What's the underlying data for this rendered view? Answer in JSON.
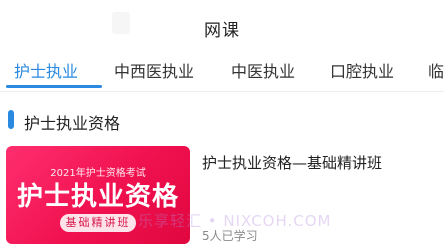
{
  "header": {
    "title": "网课"
  },
  "tabs": [
    {
      "label": "护士执业",
      "active": true
    },
    {
      "label": "中西医执业",
      "active": false
    },
    {
      "label": "中医执业",
      "active": false
    },
    {
      "label": "口腔执业",
      "active": false
    },
    {
      "label": "临",
      "active": false
    }
  ],
  "section": {
    "title": "护士执业资格"
  },
  "course": {
    "cover": {
      "subtitle": "2021年护士资格考试",
      "headline": "护士执业资格",
      "badge": "基础精讲班"
    },
    "title": "护士执业资格—基础精讲班",
    "learners": "5人已学习"
  },
  "watermark": "乐享轻汇 • NIXCOH.COM",
  "colors": {
    "accent": "#2a89e0",
    "cover": "#f0114f"
  }
}
